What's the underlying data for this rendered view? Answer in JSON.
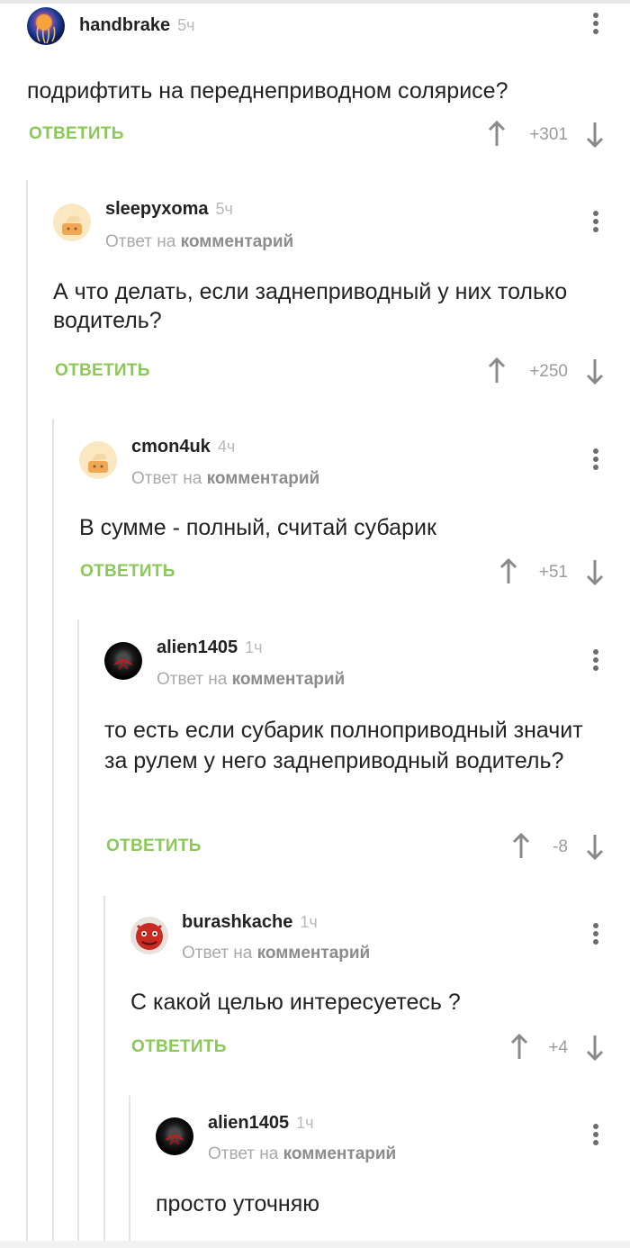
{
  "reply_label": "ОТВЕТИТЬ",
  "reply_to_prefix": "Ответ на",
  "reply_to_target": "комментарий",
  "comments": [
    {
      "user": "handbrake",
      "time": "5ч",
      "text": "подрифтить на переднеприводном солярисе?",
      "score": "+301",
      "avatar": "jellyfish-avatar"
    },
    {
      "user": "sleepyxoma",
      "time": "5ч",
      "text": "А что делать, если заднеприводный у них только водитель?",
      "score": "+250",
      "avatar": "default-cake-avatar"
    },
    {
      "user": "cmon4uk",
      "time": "4ч",
      "text": "В сумме - полный, считай субарик",
      "score": "+51",
      "avatar": "default-cake-avatar"
    },
    {
      "user": "alien1405",
      "time": "1ч",
      "text": "то есть если субарик полноприводный значит за рулем у него заднеприводный водитель?",
      "score": "-8",
      "avatar": "dark-helmet-avatar"
    },
    {
      "user": "burashkache",
      "time": "1ч",
      "text": "С какой целью интересуетесь ?",
      "score": "+4",
      "avatar": "red-creature-avatar"
    },
    {
      "user": "alien1405",
      "time": "1ч",
      "text": "просто уточняю",
      "score": "",
      "avatar": "dark-helmet-avatar"
    }
  ]
}
